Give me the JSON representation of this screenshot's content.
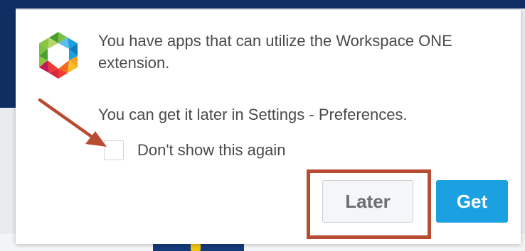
{
  "dialog": {
    "message": "You have apps that can utilize the Workspace ONE extension.",
    "hint": "You can get it later in Settings - Preferences.",
    "checkbox_label": "Don't show this again",
    "checkbox_checked": false,
    "later_label": "Later",
    "get_label": "Get"
  },
  "colors": {
    "primary_button": "#1ba1e2",
    "annotation": "#b74c33",
    "text": "#4a4a4a"
  },
  "icons": {
    "logo": "workspace-one-logo-icon",
    "annotation_arrow": "arrow-annotation-icon"
  }
}
